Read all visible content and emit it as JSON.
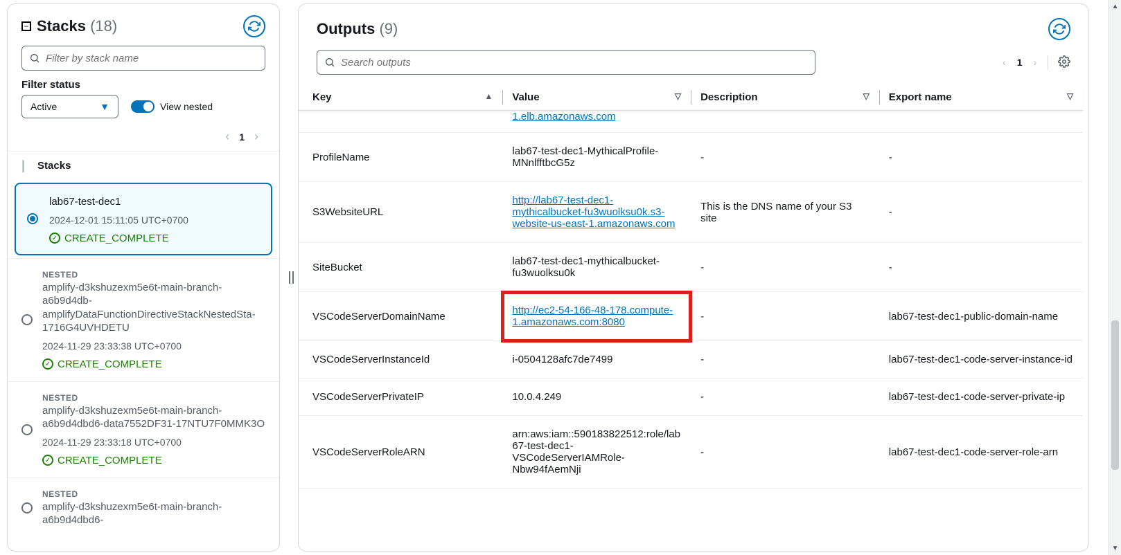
{
  "sidebar": {
    "title": "Stacks",
    "count": "(18)",
    "search_placeholder": "Filter by stack name",
    "filter_status_label": "Filter status",
    "filter_value": "Active",
    "view_nested_label": "View nested",
    "page_current": "1",
    "stacks_heading": "Stacks"
  },
  "stacks": [
    {
      "nested": "",
      "name": "lab67-test-dec1",
      "time": "2024-12-01 15:11:05 UTC+0700",
      "status": "CREATE_COMPLETE",
      "selected": true
    },
    {
      "nested": "NESTED",
      "name": "amplify-d3kshuzexm5e6t-main-branch-a6b9d4db-amplifyDataFunctionDirectiveStackNestedSta-1716G4UVHDETU",
      "time": "2024-11-29 23:33:38 UTC+0700",
      "status": "CREATE_COMPLETE",
      "selected": false
    },
    {
      "nested": "NESTED",
      "name": "amplify-d3kshuzexm5e6t-main-branch-a6b9d4dbd6-data7552DF31-17NTU7F0MMK3O",
      "time": "2024-11-29 23:33:18 UTC+0700",
      "status": "CREATE_COMPLETE",
      "selected": false
    },
    {
      "nested": "NESTED",
      "name": "amplify-d3kshuzexm5e6t-main-branch-a6b9d4dbd6-",
      "time": "",
      "status": "",
      "selected": false
    }
  ],
  "main": {
    "title": "Outputs",
    "count": "(9)",
    "search_placeholder": "Search outputs",
    "page_current": "1",
    "columns": {
      "key": "Key",
      "value": "Value",
      "desc": "Description",
      "export": "Export name"
    }
  },
  "rows": [
    {
      "key": "",
      "value": "1.elb.amazonaws.com",
      "link": true,
      "desc": "",
      "export": "",
      "partial": true
    },
    {
      "key": "ProfileName",
      "value": "lab67-test-dec1-MythicalProfile-MNnlfftbcG5z",
      "link": false,
      "desc": "-",
      "export": "-"
    },
    {
      "key": "S3WebsiteURL",
      "value": "http://lab67-test-dec1-mythicalbucket-fu3wuolksu0k.s3-website-us-east-1.amazonaws.com",
      "link": true,
      "desc": "This is the DNS name of your S3 site",
      "export": "-"
    },
    {
      "key": "SiteBucket",
      "value": "lab67-test-dec1-mythicalbucket-fu3wuolksu0k",
      "link": false,
      "desc": "-",
      "export": "-"
    },
    {
      "key": "VSCodeServerDomainName",
      "value": "http://ec2-54-166-48-178.compute-1.amazonaws.com:8080",
      "link": true,
      "desc": "-",
      "export": "lab67-test-dec1-public-domain-name",
      "highlight": true
    },
    {
      "key": "VSCodeServerInstanceId",
      "value": "i-0504128afc7de7499",
      "link": false,
      "desc": "-",
      "export": "lab67-test-dec1-code-server-instance-id"
    },
    {
      "key": "VSCodeServerPrivateIP",
      "value": "10.0.4.249",
      "link": false,
      "desc": "-",
      "export": "lab67-test-dec1-code-server-private-ip"
    },
    {
      "key": "VSCodeServerRoleARN",
      "value": "arn:aws:iam::590183822512:role/lab67-test-dec1-VSCodeServerIAMRole-Nbw94fAemNji",
      "link": false,
      "desc": "-",
      "export": "lab67-test-dec1-code-server-role-arn"
    }
  ]
}
